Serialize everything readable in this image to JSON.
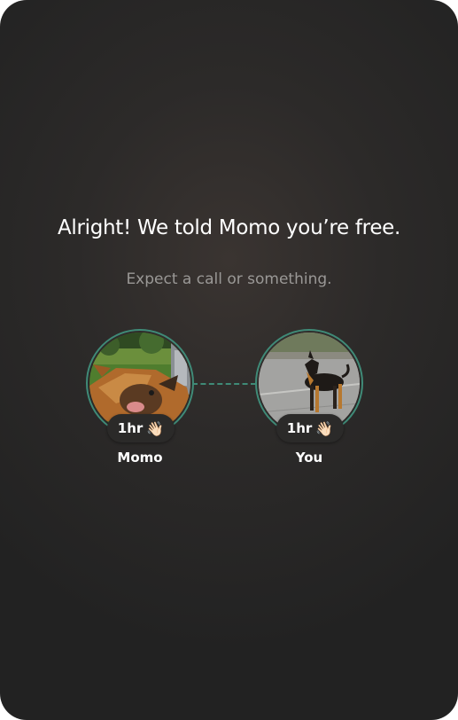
{
  "screen": {
    "headline": "Alright! We told Momo you’re free.",
    "subtitle": "Expect a call or something."
  },
  "participants": [
    {
      "name": "Momo",
      "duration": "1hr",
      "wave_emoji": "👋🏻",
      "photo_icon": "dog-photo-lying-on-grass"
    },
    {
      "name": "You",
      "duration": "1hr",
      "wave_emoji": "👋🏻",
      "photo_icon": "dog-photo-standing-on-road"
    }
  ],
  "colors": {
    "ring": "#3f8a77",
    "background": "#2a2929",
    "headline": "#ffffff",
    "subtitle": "#9a9896"
  }
}
